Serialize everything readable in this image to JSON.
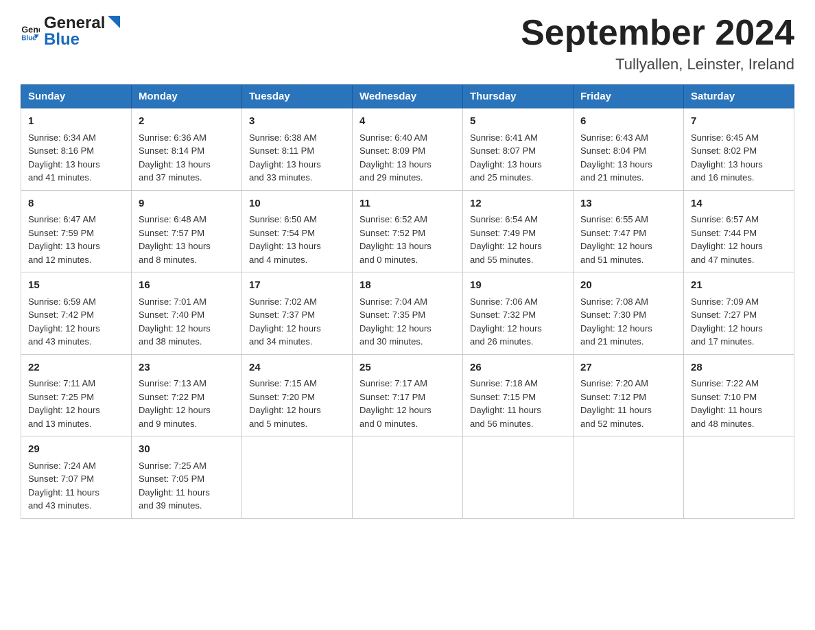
{
  "logo": {
    "text_general": "General",
    "text_blue": "Blue"
  },
  "title": "September 2024",
  "subtitle": "Tullyallen, Leinster, Ireland",
  "weekdays": [
    "Sunday",
    "Monday",
    "Tuesday",
    "Wednesday",
    "Thursday",
    "Friday",
    "Saturday"
  ],
  "weeks": [
    [
      {
        "num": "1",
        "sunrise": "6:34 AM",
        "sunset": "8:16 PM",
        "daylight": "13 hours and 41 minutes."
      },
      {
        "num": "2",
        "sunrise": "6:36 AM",
        "sunset": "8:14 PM",
        "daylight": "13 hours and 37 minutes."
      },
      {
        "num": "3",
        "sunrise": "6:38 AM",
        "sunset": "8:11 PM",
        "daylight": "13 hours and 33 minutes."
      },
      {
        "num": "4",
        "sunrise": "6:40 AM",
        "sunset": "8:09 PM",
        "daylight": "13 hours and 29 minutes."
      },
      {
        "num": "5",
        "sunrise": "6:41 AM",
        "sunset": "8:07 PM",
        "daylight": "13 hours and 25 minutes."
      },
      {
        "num": "6",
        "sunrise": "6:43 AM",
        "sunset": "8:04 PM",
        "daylight": "13 hours and 21 minutes."
      },
      {
        "num": "7",
        "sunrise": "6:45 AM",
        "sunset": "8:02 PM",
        "daylight": "13 hours and 16 minutes."
      }
    ],
    [
      {
        "num": "8",
        "sunrise": "6:47 AM",
        "sunset": "7:59 PM",
        "daylight": "13 hours and 12 minutes."
      },
      {
        "num": "9",
        "sunrise": "6:48 AM",
        "sunset": "7:57 PM",
        "daylight": "13 hours and 8 minutes."
      },
      {
        "num": "10",
        "sunrise": "6:50 AM",
        "sunset": "7:54 PM",
        "daylight": "13 hours and 4 minutes."
      },
      {
        "num": "11",
        "sunrise": "6:52 AM",
        "sunset": "7:52 PM",
        "daylight": "13 hours and 0 minutes."
      },
      {
        "num": "12",
        "sunrise": "6:54 AM",
        "sunset": "7:49 PM",
        "daylight": "12 hours and 55 minutes."
      },
      {
        "num": "13",
        "sunrise": "6:55 AM",
        "sunset": "7:47 PM",
        "daylight": "12 hours and 51 minutes."
      },
      {
        "num": "14",
        "sunrise": "6:57 AM",
        "sunset": "7:44 PM",
        "daylight": "12 hours and 47 minutes."
      }
    ],
    [
      {
        "num": "15",
        "sunrise": "6:59 AM",
        "sunset": "7:42 PM",
        "daylight": "12 hours and 43 minutes."
      },
      {
        "num": "16",
        "sunrise": "7:01 AM",
        "sunset": "7:40 PM",
        "daylight": "12 hours and 38 minutes."
      },
      {
        "num": "17",
        "sunrise": "7:02 AM",
        "sunset": "7:37 PM",
        "daylight": "12 hours and 34 minutes."
      },
      {
        "num": "18",
        "sunrise": "7:04 AM",
        "sunset": "7:35 PM",
        "daylight": "12 hours and 30 minutes."
      },
      {
        "num": "19",
        "sunrise": "7:06 AM",
        "sunset": "7:32 PM",
        "daylight": "12 hours and 26 minutes."
      },
      {
        "num": "20",
        "sunrise": "7:08 AM",
        "sunset": "7:30 PM",
        "daylight": "12 hours and 21 minutes."
      },
      {
        "num": "21",
        "sunrise": "7:09 AM",
        "sunset": "7:27 PM",
        "daylight": "12 hours and 17 minutes."
      }
    ],
    [
      {
        "num": "22",
        "sunrise": "7:11 AM",
        "sunset": "7:25 PM",
        "daylight": "12 hours and 13 minutes."
      },
      {
        "num": "23",
        "sunrise": "7:13 AM",
        "sunset": "7:22 PM",
        "daylight": "12 hours and 9 minutes."
      },
      {
        "num": "24",
        "sunrise": "7:15 AM",
        "sunset": "7:20 PM",
        "daylight": "12 hours and 5 minutes."
      },
      {
        "num": "25",
        "sunrise": "7:17 AM",
        "sunset": "7:17 PM",
        "daylight": "12 hours and 0 minutes."
      },
      {
        "num": "26",
        "sunrise": "7:18 AM",
        "sunset": "7:15 PM",
        "daylight": "11 hours and 56 minutes."
      },
      {
        "num": "27",
        "sunrise": "7:20 AM",
        "sunset": "7:12 PM",
        "daylight": "11 hours and 52 minutes."
      },
      {
        "num": "28",
        "sunrise": "7:22 AM",
        "sunset": "7:10 PM",
        "daylight": "11 hours and 48 minutes."
      }
    ],
    [
      {
        "num": "29",
        "sunrise": "7:24 AM",
        "sunset": "7:07 PM",
        "daylight": "11 hours and 43 minutes."
      },
      {
        "num": "30",
        "sunrise": "7:25 AM",
        "sunset": "7:05 PM",
        "daylight": "11 hours and 39 minutes."
      },
      null,
      null,
      null,
      null,
      null
    ]
  ],
  "labels": {
    "sunrise": "Sunrise:",
    "sunset": "Sunset:",
    "daylight": "Daylight:"
  }
}
